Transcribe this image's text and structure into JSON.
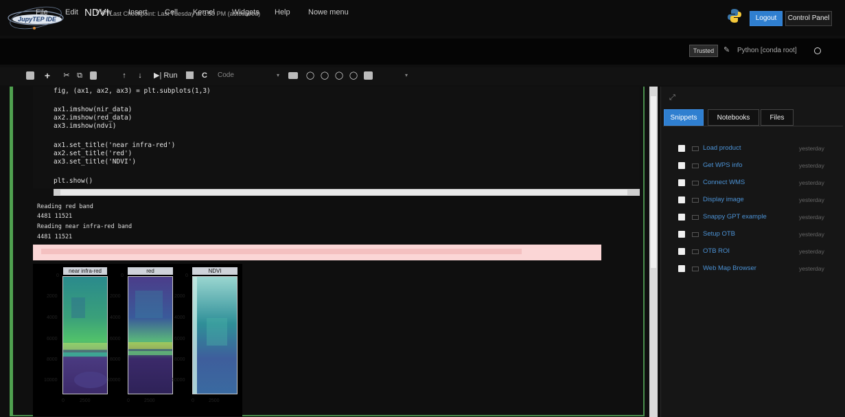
{
  "header": {
    "logo_text": "JupyTEP IDE",
    "notebook_title": "NDVI",
    "checkpoint": "Last Checkpoint: Last Tuesday at 3:50 PM  (autosaved)",
    "logout_label": "Logout",
    "control_panel_label": "Control Panel"
  },
  "menu": {
    "items": [
      "File",
      "Edit",
      "View",
      "Insert",
      "Cell",
      "Kernel",
      "Widgets",
      "Help",
      "Nowe menu"
    ],
    "trusted_label": "Trusted",
    "kernel_name": "Python [conda root]"
  },
  "toolbar": {
    "run_label": "Run",
    "cell_type": "Code"
  },
  "code": {
    "lines": [
      "fig, (ax1, ax2, ax3) = plt.subplots(1,3)",
      "",
      "ax1.imshow(nir_data)",
      "ax2.imshow(red_data)",
      "ax3.imshow(ndvi)",
      "",
      "ax1.set_title('near infra-red')",
      "ax2.set_title('red')",
      "ax3.set_title('NDVI')",
      "",
      "plt.show()"
    ]
  },
  "output": {
    "lines": [
      "Reading red band",
      "4481 11521",
      "Reading near infra-red band",
      "4481 11521"
    ]
  },
  "figure": {
    "panel_titles": [
      "near infra-red",
      "red",
      "NDVI"
    ],
    "y_ticks": [
      "2000",
      "4000",
      "6000",
      "8000",
      "10000"
    ],
    "y_tick_zero": "0",
    "x_ticks": [
      "0",
      "2500"
    ],
    "colors": {
      "viridis_dark": "#3b1f5c",
      "viridis_mid": "#2f6f8e",
      "viridis_light": "#5dc863"
    }
  },
  "sidebar": {
    "tabs": [
      "Snippets",
      "Notebooks",
      "Files"
    ],
    "snippets": [
      {
        "name": "Load product",
        "date": "yesterday"
      },
      {
        "name": "Get WPS info",
        "date": "yesterday"
      },
      {
        "name": "Connect WMS",
        "date": "yesterday"
      },
      {
        "name": "Display image",
        "date": "yesterday"
      },
      {
        "name": "Snappy GPT example",
        "date": "yesterday"
      },
      {
        "name": "Setup OTB",
        "date": "yesterday"
      },
      {
        "name": "OTB ROI",
        "date": "yesterday"
      },
      {
        "name": "Web Map Browser",
        "date": "yesterday"
      }
    ]
  },
  "icons": [
    "save-icon",
    "plus-icon",
    "scissors-icon",
    "copy-icon",
    "paste-icon",
    "arrow-up-icon",
    "arrow-down-icon",
    "run-icon",
    "stop-icon",
    "restart-icon",
    "keyboard-icon",
    "comment-icon",
    "tablet-icon",
    "python-icon",
    "pencil-icon",
    "expand-icon",
    "folder-icon"
  ]
}
